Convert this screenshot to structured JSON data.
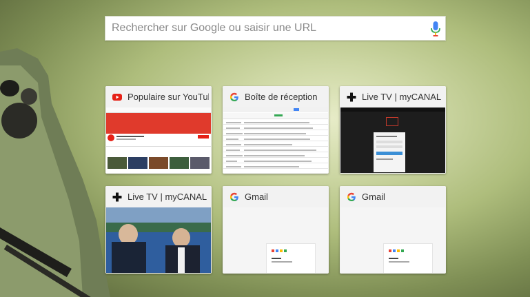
{
  "search": {
    "placeholder": "Rechercher sur Google ou saisir une URL",
    "mic_icon": "microphone-icon"
  },
  "tiles": [
    {
      "title": "Populaire sur YouTube",
      "favicon": "youtube-icon"
    },
    {
      "title": "Boîte de réception",
      "favicon": "google-g-icon"
    },
    {
      "title": "Live TV | myCANAL",
      "favicon": "canal-plus-icon"
    },
    {
      "title": "Live TV | myCANAL",
      "favicon": "canal-plus-icon"
    },
    {
      "title": "Gmail",
      "favicon": "google-g-icon"
    },
    {
      "title": "Gmail",
      "favicon": "google-g-icon"
    }
  ],
  "colors": {
    "youtube_red": "#e62117",
    "google_blue": "#4285f4",
    "google_red": "#ea4335",
    "google_yellow": "#fbbc05",
    "google_green": "#34a853"
  }
}
